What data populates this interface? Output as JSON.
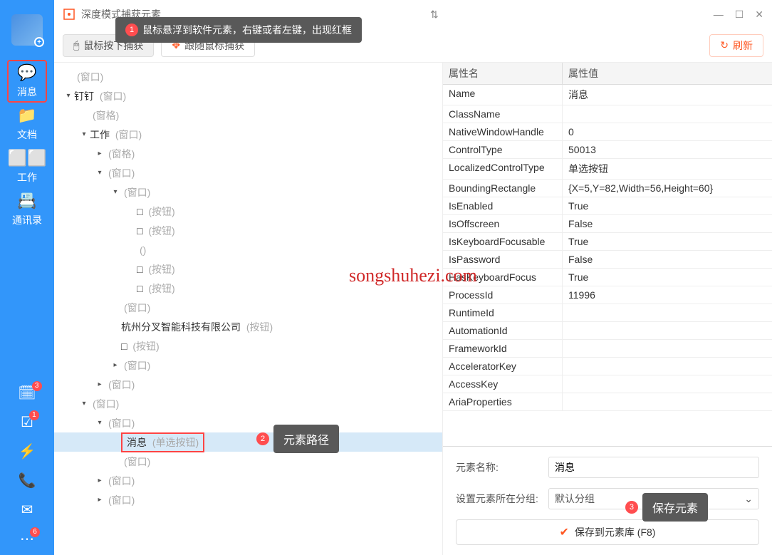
{
  "sidebar": {
    "items": [
      {
        "label": "消息",
        "icon": "chat"
      },
      {
        "label": "文档",
        "icon": "doc"
      },
      {
        "label": "工作",
        "icon": "apps"
      },
      {
        "label": "通讯录",
        "icon": "contacts"
      }
    ],
    "bottom_badges": {
      "cal": "3",
      "check": "1",
      "mail_bottom": "6"
    }
  },
  "title": "深度模式捕获元素",
  "toolbar": {
    "capture_click": "鼠标按下捕获",
    "capture_follow": "跟随鼠标捕获",
    "refresh": "刷新"
  },
  "tooltips": {
    "t1": "鼠标悬浮到软件元素，右键或者左键，出现红框",
    "t2": "元素路径",
    "t3": "保存元素"
  },
  "tree": [
    {
      "indent": 0,
      "arrow": "",
      "label": "",
      "hint": "(窗口)"
    },
    {
      "indent": 0,
      "arrow": "▾",
      "label": "钉钉 ",
      "hint": "(窗口)"
    },
    {
      "indent": 1,
      "arrow": "",
      "label": "",
      "hint": "(窗格)"
    },
    {
      "indent": 1,
      "arrow": "▾",
      "label": "工作 ",
      "hint": "(窗口)"
    },
    {
      "indent": 2,
      "arrow": "▸",
      "label": "",
      "hint": "(窗格)"
    },
    {
      "indent": 2,
      "arrow": "▾",
      "label": "",
      "hint": "(窗口)"
    },
    {
      "indent": 3,
      "arrow": "▾",
      "label": "",
      "hint": "(窗口)"
    },
    {
      "indent": 4,
      "arrow": "",
      "label": "□ ",
      "hint": "(按钮)"
    },
    {
      "indent": 4,
      "arrow": "",
      "label": "□ ",
      "hint": "(按钮)"
    },
    {
      "indent": 4,
      "arrow": "",
      "label": "",
      "hint": "()"
    },
    {
      "indent": 4,
      "arrow": "",
      "label": "□ ",
      "hint": "(按钮)"
    },
    {
      "indent": 4,
      "arrow": "",
      "label": "□ ",
      "hint": "(按钮)"
    },
    {
      "indent": 3,
      "arrow": "",
      "label": "",
      "hint": "(窗口)"
    },
    {
      "indent": 3,
      "arrow": "",
      "label": "杭州分叉智能科技有限公司 ",
      "hint": "(按钮)"
    },
    {
      "indent": 3,
      "arrow": "",
      "label": "□ ",
      "hint": "(按钮)"
    },
    {
      "indent": 3,
      "arrow": "▸",
      "label": "",
      "hint": "(窗口)"
    },
    {
      "indent": 2,
      "arrow": "▸",
      "label": "",
      "hint": "(窗口)"
    },
    {
      "indent": 1,
      "arrow": "▾",
      "label": "",
      "hint": "(窗口)"
    },
    {
      "indent": 2,
      "arrow": "▾",
      "label": "",
      "hint": "(窗口)"
    },
    {
      "indent": 3,
      "arrow": "",
      "label": "消息 ",
      "hint": "(单选按钮)",
      "selected": true
    },
    {
      "indent": 3,
      "arrow": "",
      "label": "",
      "hint": "(窗口)"
    },
    {
      "indent": 2,
      "arrow": "▸",
      "label": "",
      "hint": "(窗口)"
    },
    {
      "indent": 2,
      "arrow": "▸",
      "label": "",
      "hint": "(窗口)"
    }
  ],
  "props": {
    "header_name": "属性名",
    "header_value": "属性值",
    "rows": [
      {
        "n": "Name",
        "v": "消息"
      },
      {
        "n": "ClassName",
        "v": ""
      },
      {
        "n": "NativeWindowHandle",
        "v": "0"
      },
      {
        "n": "ControlType",
        "v": "50013"
      },
      {
        "n": "LocalizedControlType",
        "v": "单选按钮"
      },
      {
        "n": "BoundingRectangle",
        "v": "{X=5,Y=82,Width=56,Height=60}"
      },
      {
        "n": "IsEnabled",
        "v": "True"
      },
      {
        "n": "IsOffscreen",
        "v": "False"
      },
      {
        "n": "IsKeyboardFocusable",
        "v": "True"
      },
      {
        "n": "IsPassword",
        "v": "False"
      },
      {
        "n": "HasKeyboardFocus",
        "v": "True"
      },
      {
        "n": "ProcessId",
        "v": "11996"
      },
      {
        "n": "RuntimeId",
        "v": ""
      },
      {
        "n": "AutomationId",
        "v": ""
      },
      {
        "n": "FrameworkId",
        "v": ""
      },
      {
        "n": "AcceleratorKey",
        "v": ""
      },
      {
        "n": "AccessKey",
        "v": ""
      },
      {
        "n": "AriaProperties",
        "v": ""
      }
    ]
  },
  "form": {
    "name_label": "元素名称:",
    "name_value": "消息",
    "group_label": "设置元素所在分组:",
    "group_value": "默认分组",
    "save_label": "保存到元素库 (F8)"
  },
  "watermark": "songshuhezi.com"
}
